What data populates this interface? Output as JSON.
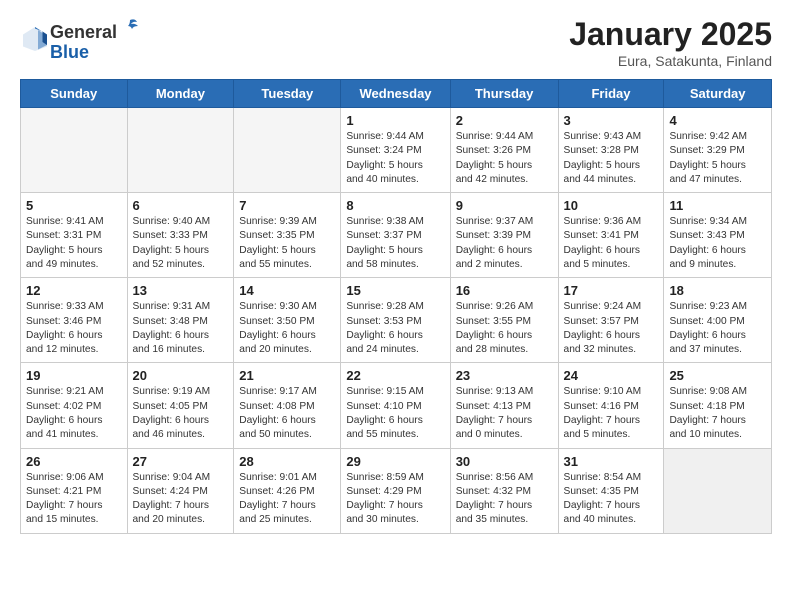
{
  "logo": {
    "general": "General",
    "blue": "Blue"
  },
  "title": "January 2025",
  "subtitle": "Eura, Satakunta, Finland",
  "days_of_week": [
    "Sunday",
    "Monday",
    "Tuesday",
    "Wednesday",
    "Thursday",
    "Friday",
    "Saturday"
  ],
  "weeks": [
    [
      {
        "day": "",
        "info": ""
      },
      {
        "day": "",
        "info": ""
      },
      {
        "day": "",
        "info": ""
      },
      {
        "day": "1",
        "info": "Sunrise: 9:44 AM\nSunset: 3:24 PM\nDaylight: 5 hours\nand 40 minutes."
      },
      {
        "day": "2",
        "info": "Sunrise: 9:44 AM\nSunset: 3:26 PM\nDaylight: 5 hours\nand 42 minutes."
      },
      {
        "day": "3",
        "info": "Sunrise: 9:43 AM\nSunset: 3:28 PM\nDaylight: 5 hours\nand 44 minutes."
      },
      {
        "day": "4",
        "info": "Sunrise: 9:42 AM\nSunset: 3:29 PM\nDaylight: 5 hours\nand 47 minutes."
      }
    ],
    [
      {
        "day": "5",
        "info": "Sunrise: 9:41 AM\nSunset: 3:31 PM\nDaylight: 5 hours\nand 49 minutes."
      },
      {
        "day": "6",
        "info": "Sunrise: 9:40 AM\nSunset: 3:33 PM\nDaylight: 5 hours\nand 52 minutes."
      },
      {
        "day": "7",
        "info": "Sunrise: 9:39 AM\nSunset: 3:35 PM\nDaylight: 5 hours\nand 55 minutes."
      },
      {
        "day": "8",
        "info": "Sunrise: 9:38 AM\nSunset: 3:37 PM\nDaylight: 5 hours\nand 58 minutes."
      },
      {
        "day": "9",
        "info": "Sunrise: 9:37 AM\nSunset: 3:39 PM\nDaylight: 6 hours\nand 2 minutes."
      },
      {
        "day": "10",
        "info": "Sunrise: 9:36 AM\nSunset: 3:41 PM\nDaylight: 6 hours\nand 5 minutes."
      },
      {
        "day": "11",
        "info": "Sunrise: 9:34 AM\nSunset: 3:43 PM\nDaylight: 6 hours\nand 9 minutes."
      }
    ],
    [
      {
        "day": "12",
        "info": "Sunrise: 9:33 AM\nSunset: 3:46 PM\nDaylight: 6 hours\nand 12 minutes."
      },
      {
        "day": "13",
        "info": "Sunrise: 9:31 AM\nSunset: 3:48 PM\nDaylight: 6 hours\nand 16 minutes."
      },
      {
        "day": "14",
        "info": "Sunrise: 9:30 AM\nSunset: 3:50 PM\nDaylight: 6 hours\nand 20 minutes."
      },
      {
        "day": "15",
        "info": "Sunrise: 9:28 AM\nSunset: 3:53 PM\nDaylight: 6 hours\nand 24 minutes."
      },
      {
        "day": "16",
        "info": "Sunrise: 9:26 AM\nSunset: 3:55 PM\nDaylight: 6 hours\nand 28 minutes."
      },
      {
        "day": "17",
        "info": "Sunrise: 9:24 AM\nSunset: 3:57 PM\nDaylight: 6 hours\nand 32 minutes."
      },
      {
        "day": "18",
        "info": "Sunrise: 9:23 AM\nSunset: 4:00 PM\nDaylight: 6 hours\nand 37 minutes."
      }
    ],
    [
      {
        "day": "19",
        "info": "Sunrise: 9:21 AM\nSunset: 4:02 PM\nDaylight: 6 hours\nand 41 minutes."
      },
      {
        "day": "20",
        "info": "Sunrise: 9:19 AM\nSunset: 4:05 PM\nDaylight: 6 hours\nand 46 minutes."
      },
      {
        "day": "21",
        "info": "Sunrise: 9:17 AM\nSunset: 4:08 PM\nDaylight: 6 hours\nand 50 minutes."
      },
      {
        "day": "22",
        "info": "Sunrise: 9:15 AM\nSunset: 4:10 PM\nDaylight: 6 hours\nand 55 minutes."
      },
      {
        "day": "23",
        "info": "Sunrise: 9:13 AM\nSunset: 4:13 PM\nDaylight: 7 hours\nand 0 minutes."
      },
      {
        "day": "24",
        "info": "Sunrise: 9:10 AM\nSunset: 4:16 PM\nDaylight: 7 hours\nand 5 minutes."
      },
      {
        "day": "25",
        "info": "Sunrise: 9:08 AM\nSunset: 4:18 PM\nDaylight: 7 hours\nand 10 minutes."
      }
    ],
    [
      {
        "day": "26",
        "info": "Sunrise: 9:06 AM\nSunset: 4:21 PM\nDaylight: 7 hours\nand 15 minutes."
      },
      {
        "day": "27",
        "info": "Sunrise: 9:04 AM\nSunset: 4:24 PM\nDaylight: 7 hours\nand 20 minutes."
      },
      {
        "day": "28",
        "info": "Sunrise: 9:01 AM\nSunset: 4:26 PM\nDaylight: 7 hours\nand 25 minutes."
      },
      {
        "day": "29",
        "info": "Sunrise: 8:59 AM\nSunset: 4:29 PM\nDaylight: 7 hours\nand 30 minutes."
      },
      {
        "day": "30",
        "info": "Sunrise: 8:56 AM\nSunset: 4:32 PM\nDaylight: 7 hours\nand 35 minutes."
      },
      {
        "day": "31",
        "info": "Sunrise: 8:54 AM\nSunset: 4:35 PM\nDaylight: 7 hours\nand 40 minutes."
      },
      {
        "day": "",
        "info": ""
      }
    ]
  ]
}
